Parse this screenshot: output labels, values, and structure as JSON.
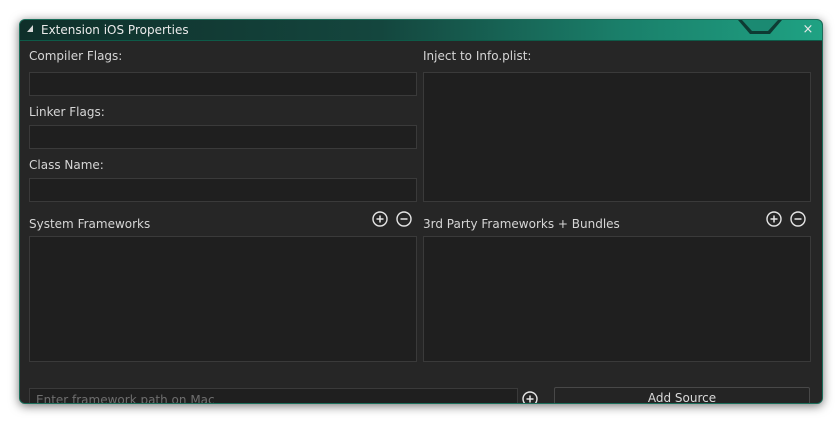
{
  "window": {
    "title": "Extension iOS Properties",
    "close_glyph": "×",
    "accent_color": "#1fa283"
  },
  "left": {
    "compiler_flags_label": "Compiler Flags:",
    "compiler_flags_value": "",
    "linker_flags_label": "Linker Flags:",
    "linker_flags_value": "",
    "class_name_label": "Class Name:",
    "class_name_value": "",
    "system_frameworks_label": "System Frameworks"
  },
  "right": {
    "inject_plist_label": "Inject to Info.plist:",
    "third_party_label": "3rd Party Frameworks + Bundles"
  },
  "footer": {
    "path_placeholder": "Enter framework path on Mac",
    "path_value": "",
    "add_source_label": "Add Source"
  },
  "icons": {
    "add": "plus-circle-icon",
    "remove": "minus-circle-icon",
    "collapse": "triangle-icon",
    "close": "close-icon"
  }
}
